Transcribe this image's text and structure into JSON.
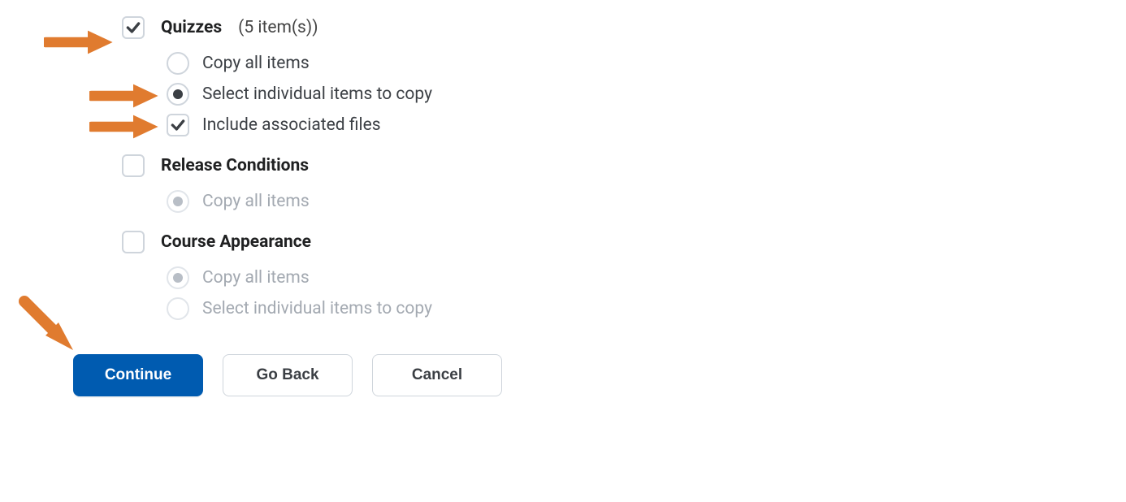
{
  "sections": {
    "quizzes": {
      "label": "Quizzes",
      "count": "(5 item(s))",
      "options": {
        "copy_all": "Copy all items",
        "select_individual": "Select individual items to copy",
        "include_files": "Include associated files"
      }
    },
    "release": {
      "label": "Release Conditions",
      "options": {
        "copy_all": "Copy all items"
      }
    },
    "appearance": {
      "label": "Course Appearance",
      "options": {
        "copy_all": "Copy all items",
        "select_individual": "Select individual items to copy"
      }
    }
  },
  "buttons": {
    "continue": "Continue",
    "go_back": "Go Back",
    "cancel": "Cancel"
  }
}
